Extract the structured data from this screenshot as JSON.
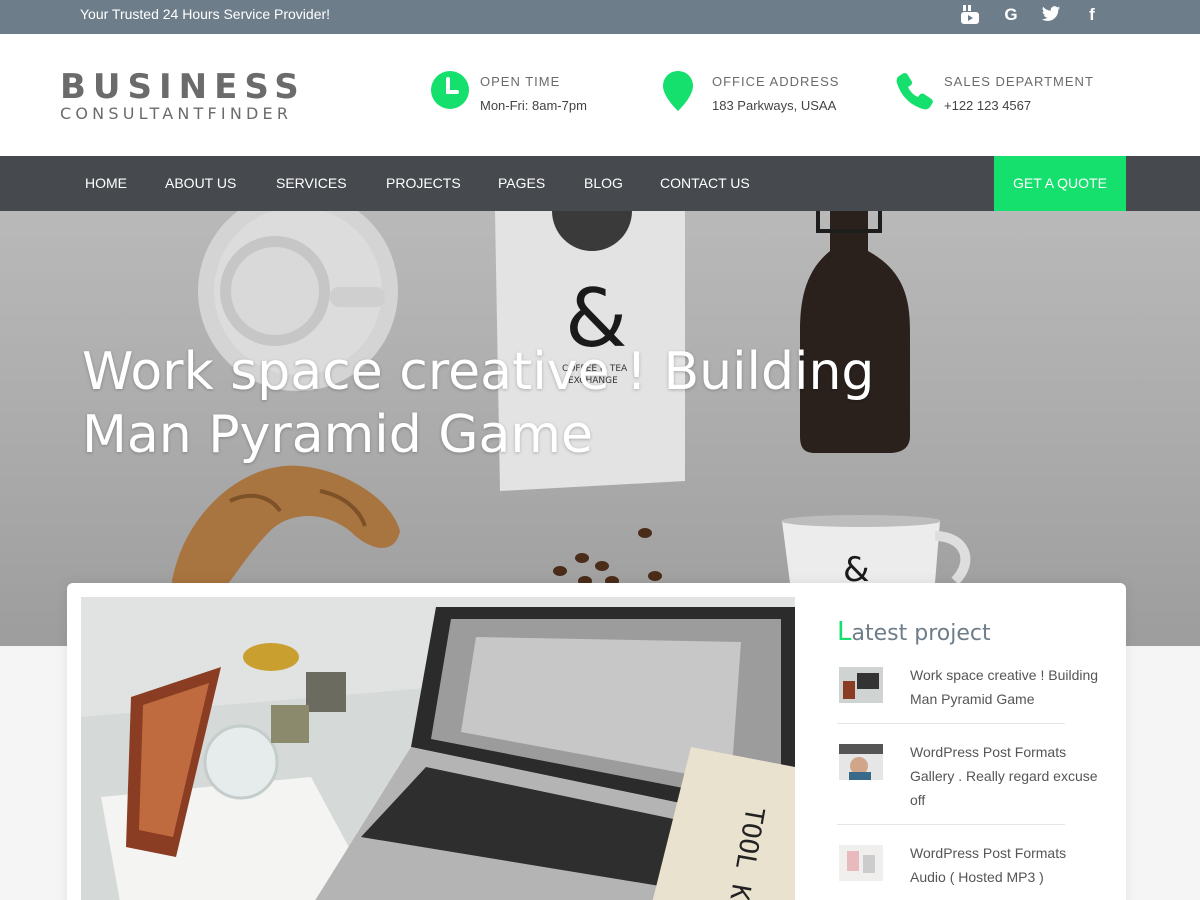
{
  "topbar": {
    "tagline": "Your Trusted 24 Hours Service Provider!",
    "social": [
      {
        "icon": "youtube-icon",
        "glyph": "▶"
      },
      {
        "icon": "google-icon",
        "glyph": "G"
      },
      {
        "icon": "twitter-icon",
        "glyph": "t"
      },
      {
        "icon": "facebook-icon",
        "glyph": "f"
      }
    ]
  },
  "header": {
    "logo_top": "BUSINESS",
    "logo_bottom": "CONSULTANTFINDER",
    "info": [
      {
        "icon": "clock-icon",
        "title": "OPEN TIME",
        "value": "Mon-Fri: 8am-7pm"
      },
      {
        "icon": "map-pin-icon",
        "title": "OFFICE ADDRESS",
        "value": "183 Parkways, USAA"
      },
      {
        "icon": "phone-icon",
        "title": "SALES DEPARTMENT",
        "value": "+122 123 4567"
      }
    ]
  },
  "nav": {
    "items": [
      "HOME",
      "ABOUT US",
      "SERVICES",
      "PROJECTS",
      "PAGES",
      "BLOG",
      "CONTACT US"
    ],
    "cta": "GET A QUOTE"
  },
  "hero": {
    "title": "Work space creative ! Building Man Pyramid Game"
  },
  "sidebar": {
    "title_first": "L",
    "title_rest": "atest project",
    "projects": [
      {
        "title": "Work space creative ! Building Man Pyramid Game"
      },
      {
        "title": "WordPress Post Formats Gallery . Really regard excuse off"
      },
      {
        "title": "WordPress Post Formats Audio ( Hosted MP3 )"
      }
    ]
  },
  "colors": {
    "accent": "#16e06d",
    "topbar": "#6e7d8a",
    "nav": "#404448"
  }
}
